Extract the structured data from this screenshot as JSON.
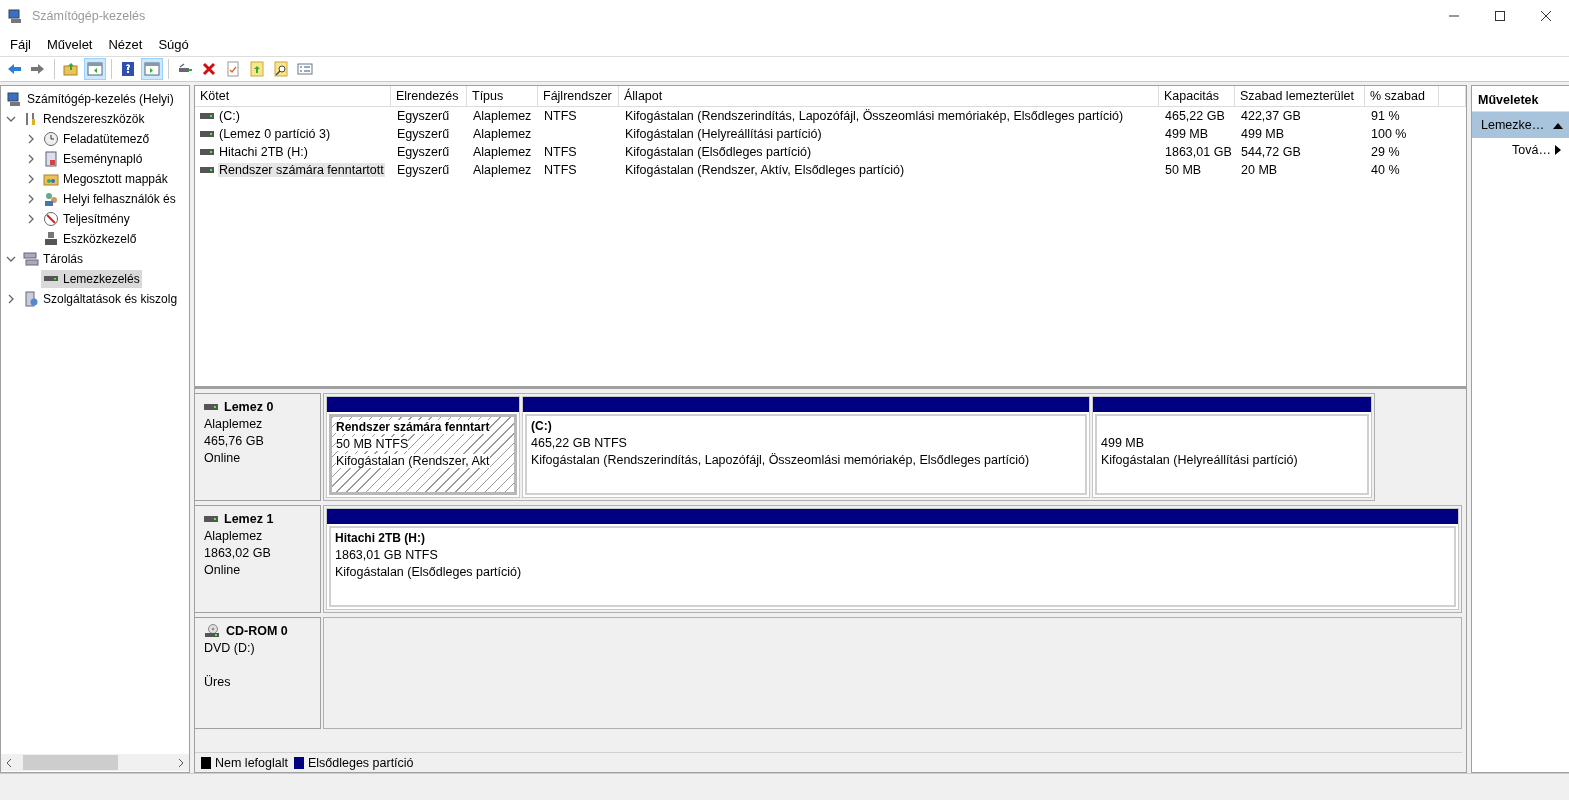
{
  "window": {
    "title": "Számítógép-kezelés"
  },
  "menu": [
    {
      "label": "Fájl"
    },
    {
      "label": "Művelet"
    },
    {
      "label": "Nézet"
    },
    {
      "label": "Súgó"
    }
  ],
  "toolbar": [
    {
      "kind": "back",
      "pressed": false
    },
    {
      "kind": "forward",
      "pressed": false
    },
    {
      "kind": "separator"
    },
    {
      "kind": "up",
      "pressed": false
    },
    {
      "kind": "tree",
      "pressed": true
    },
    {
      "kind": "separator"
    },
    {
      "kind": "help",
      "pressed": false
    },
    {
      "kind": "pane",
      "pressed": true
    },
    {
      "kind": "separator"
    },
    {
      "kind": "connect",
      "pressed": false
    },
    {
      "kind": "delete",
      "pressed": false
    },
    {
      "kind": "properties",
      "pressed": false
    },
    {
      "kind": "export",
      "pressed": false
    },
    {
      "kind": "find",
      "pressed": false
    },
    {
      "kind": "list",
      "pressed": false
    }
  ],
  "tree": [
    {
      "label": "Számítógép-kezelés (Helyi)",
      "selected": false,
      "children": [
        {
          "label": "Rendszereszközök",
          "selected": false,
          "expanded": true,
          "children": [
            {
              "label": "Feladatütemező",
              "selected": false,
              "expanded": false
            },
            {
              "label": "Eseménynapló",
              "selected": false,
              "expanded": false
            },
            {
              "label": "Megosztott mappák",
              "selected": false,
              "expanded": false
            },
            {
              "label": "Helyi felhasználók és",
              "selected": false,
              "expanded": false
            },
            {
              "label": "Teljesítmény",
              "selected": false,
              "expanded": false
            },
            {
              "label": "Eszközkezelő",
              "selected": false
            }
          ]
        },
        {
          "label": "Tárolás",
          "selected": false,
          "expanded": true,
          "children": [
            {
              "label": "Lemezkezelés",
              "selected": true
            }
          ]
        },
        {
          "label": "Szolgáltatások és kiszolg",
          "selected": false,
          "expanded": false
        }
      ]
    }
  ],
  "table": {
    "columns": [
      "Kötet",
      "Elrendezés",
      "Típus",
      "Fájlrendszer",
      "Állapot",
      "Kapacitás",
      "Szabad lemezterület",
      "% szabad"
    ],
    "rows": [
      {
        "selected": false,
        "cells": [
          "(C:)",
          "Egyszerű",
          "Alaplemez",
          "NTFS",
          "Kifogástalan (Rendszerindítás, Lapozófájl, Összeomlási memóriakép, Elsődleges partíció)",
          "465,22 GB",
          "422,37 GB",
          "91 %"
        ]
      },
      {
        "selected": false,
        "cells": [
          "(Lemez 0 partíció 3)",
          "Egyszerű",
          "Alaplemez",
          "",
          "Kifogástalan (Helyreállítási partíció)",
          "499 MB",
          "499 MB",
          "100 %"
        ]
      },
      {
        "selected": false,
        "cells": [
          "Hitachi 2TB (H:)",
          "Egyszerű",
          "Alaplemez",
          "NTFS",
          "Kifogástalan (Elsődleges partíció)",
          "1863,01 GB",
          "544,72 GB",
          "29 %"
        ]
      },
      {
        "selected": true,
        "cells": [
          "Rendszer számára fenntartott",
          "Egyszerű",
          "Alaplemez",
          "NTFS",
          "Kifogástalan (Rendszer, Aktív, Elsődleges partíció)",
          "50 MB",
          "20 MB",
          "40 %"
        ]
      }
    ]
  },
  "disks": [
    {
      "kind": "disk",
      "name": "Lemez 0",
      "type": "Alaplemez",
      "size": "465,76 GB",
      "status": "Online",
      "partitions": [
        {
          "title": "Rendszer számára fenntart",
          "size": "50 MB NTFS",
          "status": "Kifogástalan (Rendszer, Akt",
          "selected": true
        },
        {
          "title": "(C:)",
          "size": "465,22 GB NTFS",
          "status": "Kifogástalan (Rendszerindítás, Lapozófájl, Összeomlási memóriakép, Elsődleges partíció)",
          "selected": false
        },
        {
          "size": "499 MB",
          "status": "Kifogástalan (Helyreállítási partíció)",
          "selected": false
        }
      ]
    },
    {
      "kind": "disk",
      "name": "Lemez 1",
      "type": "Alaplemez",
      "size": "1863,02 GB",
      "status": "Online",
      "partitions": [
        {
          "title": "Hitachi 2TB  (H:)",
          "size": "1863,01 GB NTFS",
          "status": "Kifogástalan (Elsődleges partíció)",
          "selected": false
        }
      ]
    },
    {
      "kind": "cdrom",
      "name": "CD-ROM 0",
      "type": "DVD (D:)",
      "status": "Üres"
    }
  ],
  "legend": [
    {
      "label": "Nem lefoglalt",
      "color": "#000000"
    },
    {
      "label": "Elsődleges partíció",
      "color": "#000080"
    }
  ],
  "actions": {
    "title": "Műveletek",
    "items": [
      {
        "kind": "section",
        "label": "Lemezke…",
        "expanded": true
      },
      {
        "kind": "submenu",
        "label": "Tová…"
      }
    ]
  }
}
